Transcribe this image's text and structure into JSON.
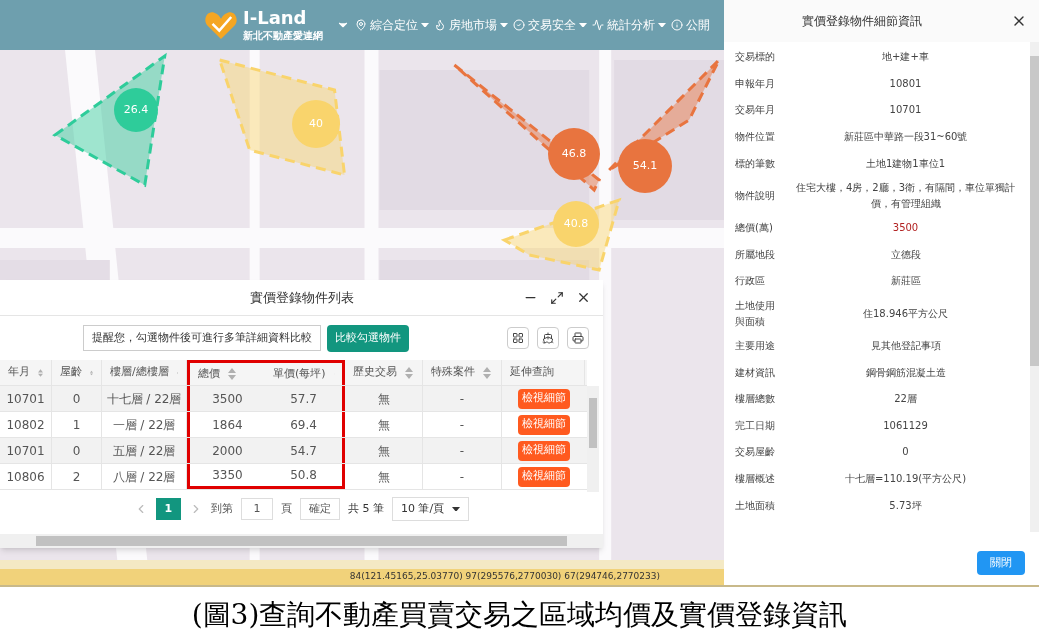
{
  "header": {
    "brand": "I-Land",
    "subtitle": "新北不動產愛連網",
    "nav": [
      {
        "label": "綜合定位"
      },
      {
        "label": "房地市場"
      },
      {
        "label": "交易安全"
      },
      {
        "label": "統計分析"
      },
      {
        "label": "公開"
      }
    ]
  },
  "map": {
    "markers": [
      {
        "label": "26.4",
        "color": "#2ecc9a"
      },
      {
        "label": "40",
        "color": "#f9d46c"
      },
      {
        "label": "46.8",
        "color": "#e8743f"
      },
      {
        "label": "54.1",
        "color": "#e8743f"
      },
      {
        "label": "40.8",
        "color": "#f9d46c"
      }
    ]
  },
  "list_panel": {
    "title": "實價登錄物件列表",
    "hint": "提醒您，勾選物件後可進行多筆詳細資料比較",
    "compare_button": "比較勾選物件",
    "columns": [
      "年月",
      "屋齡",
      "樓層/總樓層",
      "總價",
      "單價(每坪)",
      "歷史交易",
      "特殊案件",
      "延伸查詢"
    ],
    "rows": [
      [
        "10701",
        "0",
        "十七層 / 22層",
        "3500",
        "57.7",
        "無",
        "-",
        "檢視細節"
      ],
      [
        "10802",
        "1",
        "一層 / 22層",
        "1864",
        "69.4",
        "無",
        "-",
        "檢視細節"
      ],
      [
        "10701",
        "0",
        "五層 / 22層",
        "2000",
        "54.7",
        "無",
        "-",
        "檢視細節"
      ],
      [
        "10806",
        "2",
        "八層 / 22層",
        "3350",
        "50.8",
        "無",
        "-",
        "檢視細節"
      ]
    ],
    "pagination": {
      "pages": [
        {
          "label": "1",
          "selected": true
        }
      ],
      "goto_label": "到第",
      "page_value": "1",
      "page_suffix": "頁",
      "confirm": "確定",
      "total": "共 5 筆",
      "per_page": "10 筆/頁"
    }
  },
  "status_bar": "84(121.45165,25.03770) 97(295576,2770030) 67(294746,2770233)",
  "detail_panel": {
    "title": "實價登錄物件細節資訊",
    "close_button": "關閉",
    "rows": [
      {
        "label": "交易標的",
        "value": "地+建+車",
        "highlight": false
      },
      {
        "label": "申報年月",
        "value": "10801",
        "highlight": false
      },
      {
        "label": "交易年月",
        "value": "10701",
        "highlight": false
      },
      {
        "label": "物件位置",
        "value": "新莊區中華路一段31~60號",
        "highlight": false
      },
      {
        "label": "標的筆數",
        "value": "土地1建物1車位1",
        "highlight": false
      },
      {
        "label": "物件說明",
        "value": "住宅大樓，4房，2廳，3衛，有隔間，車位單獨計價，有管理組織",
        "highlight": false
      },
      {
        "label": "總價(萬)",
        "value": "3500",
        "highlight": true
      },
      {
        "label": "所屬地段",
        "value": "立德段",
        "highlight": false
      },
      {
        "label": "行政區",
        "value": "新莊區",
        "highlight": false
      },
      {
        "label": "土地使用與面積",
        "value": "住18.946平方公尺",
        "highlight": false
      },
      {
        "label": "主要用途",
        "value": "見其他登記事項",
        "highlight": false
      },
      {
        "label": "建材資訊",
        "value": "鋼骨鋼筋混凝土造",
        "highlight": false
      },
      {
        "label": "樓層總數",
        "value": "22層",
        "highlight": false
      },
      {
        "label": "完工日期",
        "value": "1061129",
        "highlight": false
      },
      {
        "label": "交易屋齡",
        "value": "0",
        "highlight": false
      },
      {
        "label": "樓層概述",
        "value": "十七層=110.19(平方公尺)",
        "highlight": false
      },
      {
        "label": "土地面積",
        "value": "5.73坪",
        "highlight": false
      }
    ]
  },
  "caption": "(圖3)查詢不動產買賣交易之區域均價及實價登錄資訊"
}
